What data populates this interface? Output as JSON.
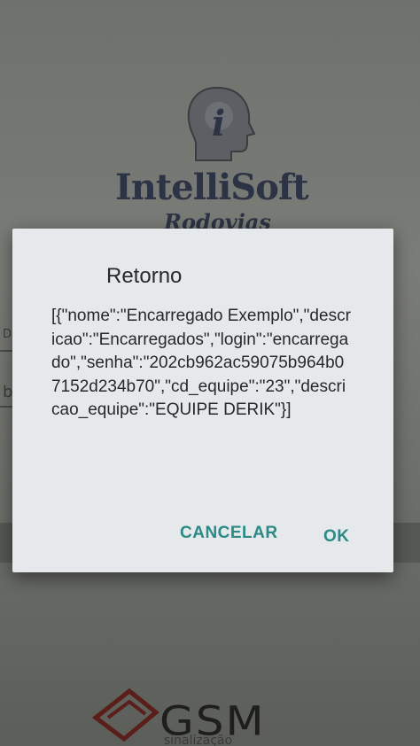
{
  "background": {
    "brand_name": "IntelliSoft",
    "brand_sub": "Rodovias",
    "field_label": "D",
    "field_value": "b",
    "footer_logo": "GSM",
    "footer_sub": "sinalização"
  },
  "dialog": {
    "title": "Retorno",
    "message": "[{\"nome\":\"Encarregado Exemplo\",\"descricao\":\"Encarregados\",\"login\":\"encarregado\",\"senha\":\"202cb962ac59075b964b07152d234b70\",\"cd_equipe\":\"23\",\"descricao_equipe\":\"EQUIPE DERIK\"}]",
    "cancel_label": "CANCELAR",
    "ok_label": "OK"
  },
  "colors": {
    "accent": "#2b8a85",
    "dialog_bg": "#e6e9ec",
    "scrim": "#6f716d"
  }
}
